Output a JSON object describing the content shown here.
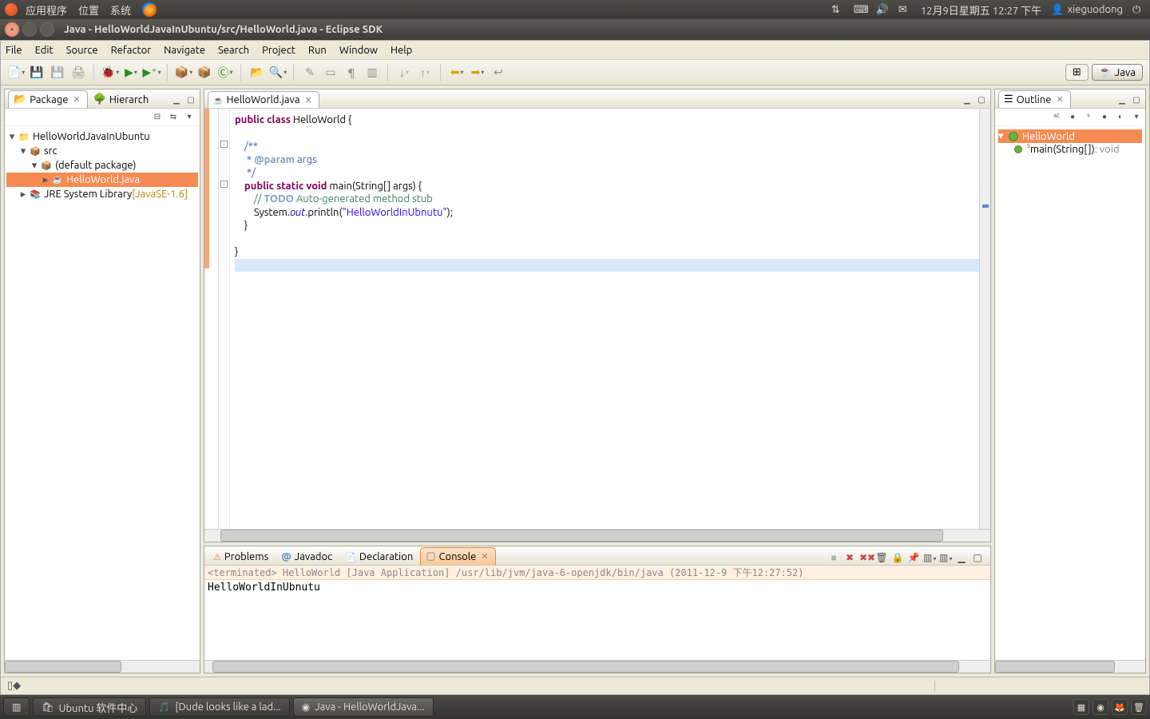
{
  "ubuntu_panel": {
    "menus": [
      "应用程序",
      "位置",
      "系统"
    ],
    "datetime": "12月9日星期五 12:27 下午",
    "user": "xieguodong"
  },
  "window": {
    "title": "Java - HelloWorldJavaInUbuntu/src/HelloWorld.java - Eclipse SDK"
  },
  "menubar": [
    "File",
    "Edit",
    "Source",
    "Refactor",
    "Navigate",
    "Search",
    "Project",
    "Run",
    "Window",
    "Help"
  ],
  "perspective": {
    "open_label": "",
    "active": "Java"
  },
  "left_tabs": {
    "package": "Package",
    "hierarchy": "Hierarch"
  },
  "package_tree": {
    "project": "HelloWorldJavaInUbuntu",
    "src": "src",
    "default_pkg": "(default package)",
    "file": "HelloWorld.java",
    "jre": "JRE System Library",
    "jre_env": "[JavaSE-1.6]"
  },
  "editor": {
    "tab": "HelloWorld.java",
    "code": {
      "l1_kw1": "public",
      "l1_kw2": "class",
      "l1_name": "HelloWorld {",
      "l3": "/**",
      "l4_a": " * ",
      "l4_tag": "@param",
      "l4_b": " args",
      "l5": " */",
      "l6_kw": "public static void",
      "l6_sig": " main(String[] args) {",
      "l7_a": "// ",
      "l7_todo": "TODO",
      "l7_b": " Auto-generated method stub",
      "l8_a": "System.",
      "l8_out": "out",
      "l8_b": ".println(",
      "l8_str": "\"HelloWorldInUbnutu\"",
      "l8_c": ");",
      "l9": "}",
      "l11": "}"
    }
  },
  "outline": {
    "tab": "Outline",
    "class": "HelloWorld",
    "method": "main(String[]) ",
    "method_ret": ": void"
  },
  "bottom": {
    "tabs": {
      "problems": "Problems",
      "javadoc": "Javadoc",
      "declaration": "Declaration",
      "console": "Console"
    },
    "console_header": "<terminated> HelloWorld [Java Application] /usr/lib/jvm/java-6-openjdk/bin/java (2011-12-9 下午12:27:52)",
    "console_output": "HelloWorldInUbnutu"
  },
  "taskbar": {
    "items": [
      "Ubuntu 软件中心",
      "[Dude looks like a lad...",
      "Java - HelloWorldJava..."
    ]
  }
}
